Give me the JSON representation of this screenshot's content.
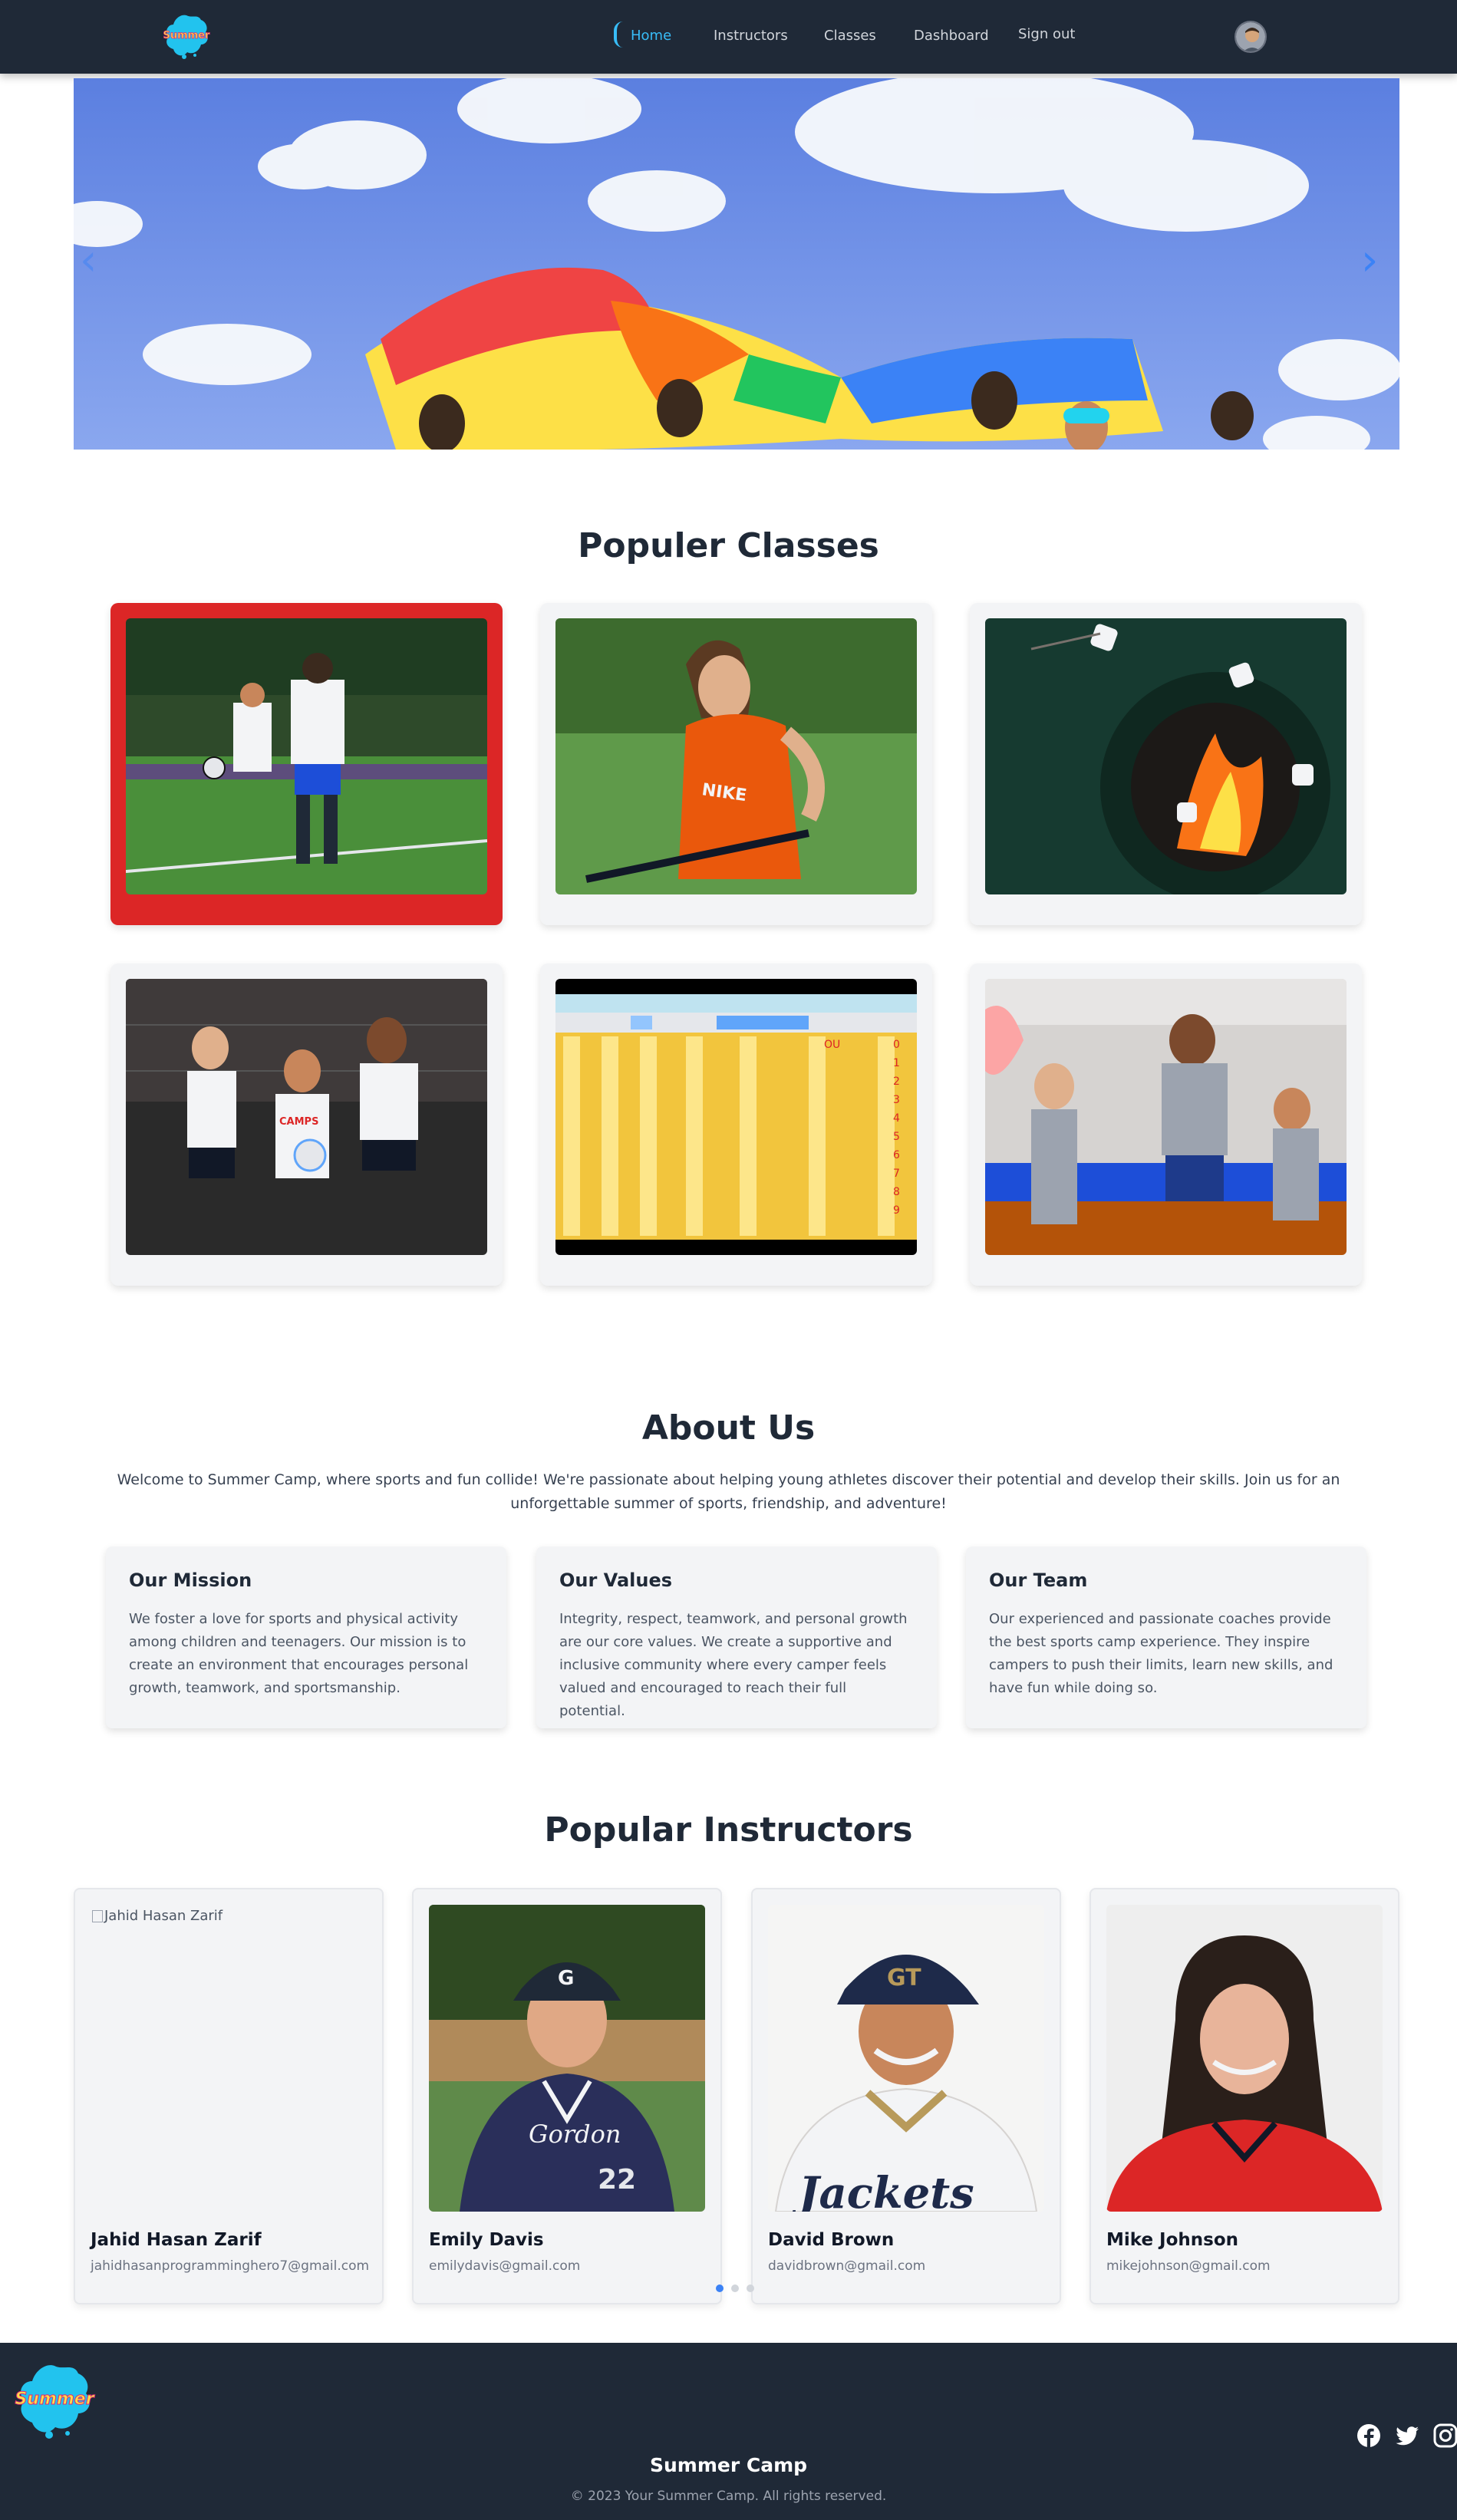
{
  "nav": {
    "links": [
      {
        "label": "Home",
        "active": true
      },
      {
        "label": "Instructors",
        "active": false
      },
      {
        "label": "Classes",
        "active": false
      },
      {
        "label": "Dashboard",
        "active": false
      },
      {
        "label": "Sign out",
        "active": false
      }
    ],
    "logo_text": "Summer"
  },
  "popular_classes": {
    "title": "Populer Classes",
    "items": [
      {
        "subject": "soccer",
        "selected": true
      },
      {
        "subject": "field-hockey"
      },
      {
        "subject": "campfire"
      },
      {
        "subject": "volleyball"
      },
      {
        "subject": "keyboard-layout-viewer"
      },
      {
        "subject": "basketball"
      }
    ]
  },
  "about": {
    "title": "About Us",
    "intro": "Welcome to Summer Camp, where sports and fun collide! We're passionate about helping young athletes discover their potential and develop their skills. Join us for an unforgettable summer of sports, friendship, and adventure!",
    "cards": [
      {
        "heading": "Our Mission",
        "body": "We foster a love for sports and physical activity among children and teenagers. Our mission is to create an environment that encourages personal growth, teamwork, and sportsmanship."
      },
      {
        "heading": "Our Values",
        "body": "Integrity, respect, teamwork, and personal growth are our core values. We create a supportive and inclusive community where every camper feels valued and encouraged to reach their full potential."
      },
      {
        "heading": "Our Team",
        "body": "Our experienced and passionate coaches provide the best sports camp experience. They inspire campers to push their limits, learn new skills, and have fun while doing so."
      }
    ]
  },
  "instructors": {
    "title": "Popular Instructors",
    "items": [
      {
        "name": "Jahid Hasan Zarif",
        "email": "jahidhasanprogramminghero7@gmail.com",
        "alt": "Jahid Hasan Zarif"
      },
      {
        "name": "Emily Davis",
        "email": "emilydavis@gmail.com"
      },
      {
        "name": "David Brown",
        "email": "davidbrown@gmail.com"
      },
      {
        "name": "Mike Johnson",
        "email": "mikejohnson@gmail.com"
      }
    ],
    "pagination": {
      "pages": 3,
      "current": 1
    }
  },
  "footer": {
    "title": "Summer Camp",
    "copyright": "© 2023 Your Summer Camp. All rights reserved.",
    "social": [
      "facebook-icon",
      "twitter-icon",
      "instagram-icon"
    ]
  },
  "colors": {
    "nav_bg": "#1f2937",
    "accent": "#38bdf8",
    "selected_card": "#dc2626",
    "card_bg": "#f3f4f6"
  }
}
